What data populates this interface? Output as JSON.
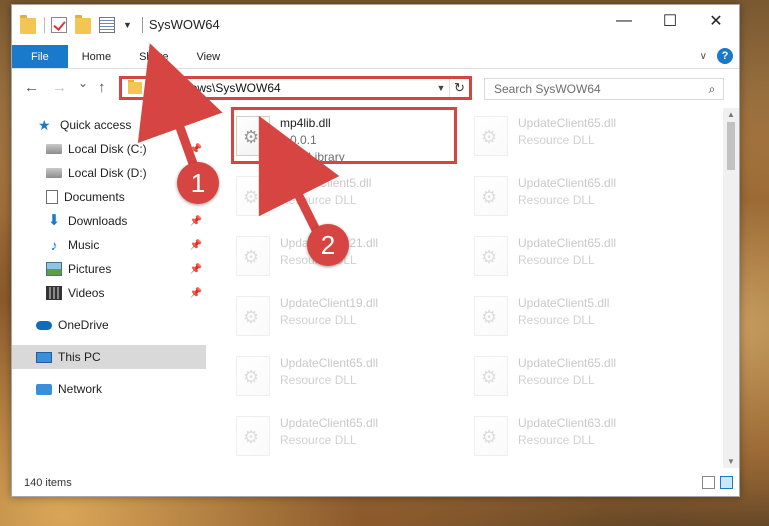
{
  "window": {
    "title": "SysWOW64",
    "controls": {
      "minimize": "—",
      "maximize": "☐",
      "close": "✕"
    }
  },
  "ribbon": {
    "tabs": [
      "File",
      "Home",
      "Share",
      "View"
    ],
    "expand_icon": "chevron-down-icon",
    "help_label": "?"
  },
  "navigation": {
    "back": "←",
    "forward": "→",
    "recent": "⌄",
    "up": "↑",
    "address": "C:\\Windows\\SysWOW64",
    "refresh": "↻",
    "search_placeholder": "Search SysWOW64",
    "search_icon": "⌕"
  },
  "sidebar": {
    "items": [
      {
        "label": "Quick access",
        "icon": "star-icon",
        "pinned": false
      },
      {
        "label": "Local Disk (C:)",
        "icon": "disk-icon",
        "pinned": true
      },
      {
        "label": "Local Disk (D:)",
        "icon": "disk-icon",
        "pinned": false
      },
      {
        "label": "Documents",
        "icon": "documents-icon",
        "pinned": false
      },
      {
        "label": "Downloads",
        "icon": "downloads-icon",
        "pinned": true
      },
      {
        "label": "Music",
        "icon": "music-icon",
        "pinned": true
      },
      {
        "label": "Pictures",
        "icon": "pictures-icon",
        "pinned": true
      },
      {
        "label": "Videos",
        "icon": "videos-icon",
        "pinned": true
      },
      {
        "label": "OneDrive",
        "icon": "onedrive-icon",
        "pinned": false
      },
      {
        "label": "This PC",
        "icon": "this-pc-icon",
        "pinned": false,
        "selected": true
      },
      {
        "label": "Network",
        "icon": "network-icon",
        "pinned": false
      }
    ]
  },
  "files": {
    "highlighted": {
      "name": "mp4lib.dll",
      "version": "1.0.0.1",
      "description": "MP4 Library"
    },
    "left_column": [
      {
        "name": "UpdateClient5.dll",
        "type": "Resource DLL"
      },
      {
        "name": "UpdateClient21.dll",
        "type": "Resource DLL"
      },
      {
        "name": "UpdateClient19.dll",
        "type": "Resource DLL"
      },
      {
        "name": "UpdateClient65.dll",
        "type": "Resource DLL"
      },
      {
        "name": "UpdateClient65.dll",
        "type": "Resource DLL"
      }
    ],
    "right_column": [
      {
        "name": "UpdateClient65.dll",
        "type": "Resource DLL"
      },
      {
        "name": "UpdateClient65.dll",
        "type": "Resource DLL"
      },
      {
        "name": "UpdateClient65.dll",
        "type": "Resource DLL"
      },
      {
        "name": "UpdateClient5.dll",
        "type": "Resource DLL"
      },
      {
        "name": "UpdateClient65.dll",
        "type": "Resource DLL"
      },
      {
        "name": "UpdateClient63.dll",
        "type": "Resource DLL"
      }
    ]
  },
  "status": {
    "item_count": "140 items"
  },
  "annotations": {
    "step1": "1",
    "step2": "2",
    "color": "#d64541"
  },
  "colors": {
    "accent": "#1979ca",
    "annotation_red": "#d64541"
  }
}
